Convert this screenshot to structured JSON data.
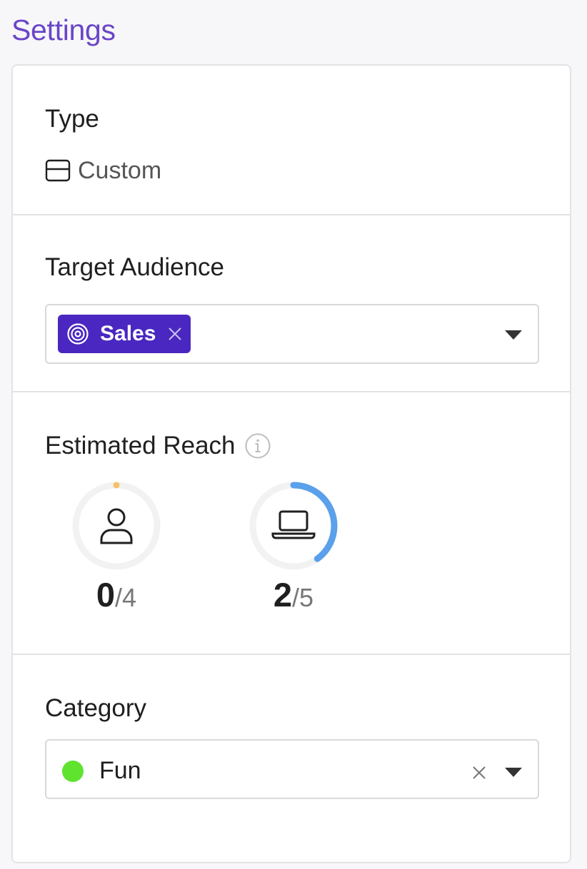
{
  "page": {
    "title": "Settings"
  },
  "type_section": {
    "label": "Type",
    "value": "Custom",
    "icon": "card-icon"
  },
  "audience_section": {
    "label": "Target Audience",
    "selected": [
      {
        "label": "Sales",
        "icon": "target-icon"
      }
    ],
    "tag_color": "#4a27c0"
  },
  "reach_section": {
    "label": "Estimated Reach",
    "info_icon": "info-icon",
    "meters": [
      {
        "icon": "user-icon",
        "value": "0",
        "total": "/4",
        "fraction": 0.0,
        "color": "#f5c26b"
      },
      {
        "icon": "laptop-icon",
        "value": "2",
        "total": "/5",
        "fraction": 0.4,
        "color": "#5aa0ea"
      }
    ]
  },
  "category_section": {
    "label": "Category",
    "value": "Fun",
    "dot_color": "#5fe32e"
  }
}
